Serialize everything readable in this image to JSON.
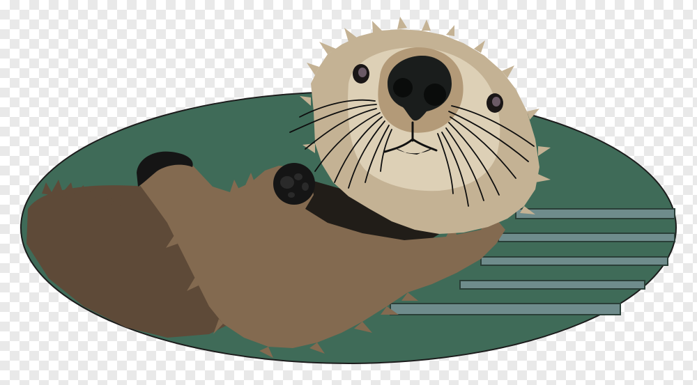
{
  "illustration": {
    "subject": "sea-otter",
    "colors": {
      "water": "#3f6b58",
      "water_outline": "#1c1c1c",
      "ripple": "#6f8c8c",
      "ripple_line": "#2a3f38",
      "body_dark": "#5e4a38",
      "body_mid": "#836a50",
      "head_fur": "#c4b294",
      "face_light": "#ddd0b6",
      "muzzle": "#b39a78",
      "nose": "#1a1d1c",
      "paw": "#151515",
      "whisker": "#0e0e0e"
    }
  }
}
